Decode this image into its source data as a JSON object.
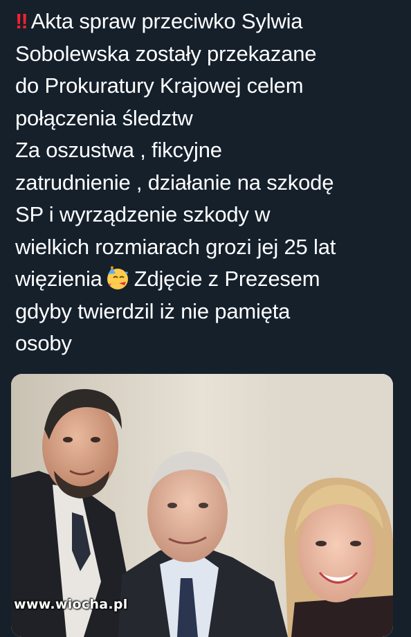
{
  "post": {
    "alert_icon": "double-exclamation-icon",
    "alert_glyph": "‼",
    "lines": [
      "Akta spraw przeciwko Sylwia",
      "Sobolewska zostały przekazane",
      "do Prokuratury Krajowej celem",
      "połączenia śledztw",
      "Za oszustwa , fikcyjne",
      "zatrudnienie , działanie na szkodę",
      "SP i wyrządzenie szkody w",
      "wielkich rozmiarach grozi jej 25 lat"
    ],
    "line_before_emoji": "więzienia",
    "emoji_icon": "partying-face-icon",
    "line_after_emoji": "Zdjęcie z Prezesem",
    "lines_end": [
      "gdyby twierdzil iż nie pamięta",
      "osoby"
    ]
  },
  "media": {
    "image_icon": "photo-three-people"
  },
  "watermark": {
    "text": "www.wiocha.pl"
  },
  "colors": {
    "background": "#15202b",
    "text": "#ffffff",
    "alert": "#f4212e"
  }
}
